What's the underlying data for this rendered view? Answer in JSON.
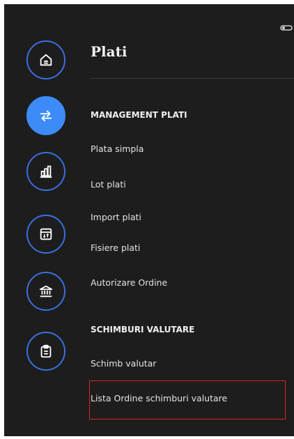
{
  "page": {
    "title": "Plati"
  },
  "rail": {
    "items": [
      {
        "icon": "home-icon",
        "active": false
      },
      {
        "icon": "transfer-arrows-icon",
        "active": true
      },
      {
        "icon": "bar-chart-icon",
        "active": false
      },
      {
        "icon": "calendar-icon",
        "active": false
      },
      {
        "icon": "bank-icon",
        "active": false
      },
      {
        "icon": "clipboard-icon",
        "active": false
      }
    ],
    "colors": {
      "ring": "#3b6fe0",
      "active_fill": "#3d8bf8"
    }
  },
  "sections": [
    {
      "header": "MANAGEMENT PLATI",
      "items": [
        {
          "label": "Plata simpla"
        },
        {
          "label": "Lot plati"
        },
        {
          "label": "Import plati"
        },
        {
          "label": "Fisiere plati"
        },
        {
          "label": "Autorizare Ordine"
        }
      ]
    },
    {
      "header": "SCHIMBURI VALUTARE",
      "items": [
        {
          "label": "Schimb valutar"
        },
        {
          "label": "Lista Ordine schimburi valutare",
          "highlighted": true
        }
      ]
    }
  ],
  "colors": {
    "background": "#1d1d1d",
    "highlight": "#d8262d"
  }
}
